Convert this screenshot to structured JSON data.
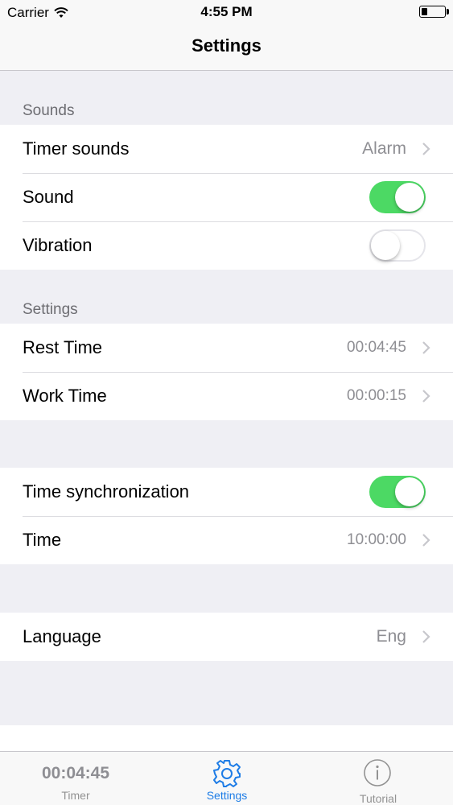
{
  "status_bar": {
    "carrier": "Carrier",
    "time": "4:55 PM"
  },
  "nav": {
    "title": "Settings"
  },
  "sounds": {
    "header": "Sounds",
    "timer_sounds": {
      "label": "Timer sounds",
      "value": "Alarm"
    },
    "sound": {
      "label": "Sound",
      "on": true
    },
    "vibration": {
      "label": "Vibration",
      "on": false
    }
  },
  "settings": {
    "header": "Settings",
    "rest_time": {
      "label": "Rest Time",
      "value": "00:04:45"
    },
    "work_time": {
      "label": "Work Time",
      "value": "00:00:15"
    }
  },
  "sync": {
    "time_sync": {
      "label": "Time synchronization",
      "on": true
    },
    "time": {
      "label": "Time",
      "value": "10:00:00"
    }
  },
  "language": {
    "label": "Language",
    "value": "Eng"
  },
  "tabbar": {
    "timer": {
      "value": "00:04:45",
      "label": "Timer"
    },
    "settings": {
      "label": "Settings"
    },
    "tutorial": {
      "label": "Tutorial"
    }
  },
  "colors": {
    "accent": "#1d7ce6",
    "toggle_on": "#4cd964",
    "background": "#efeff4"
  }
}
